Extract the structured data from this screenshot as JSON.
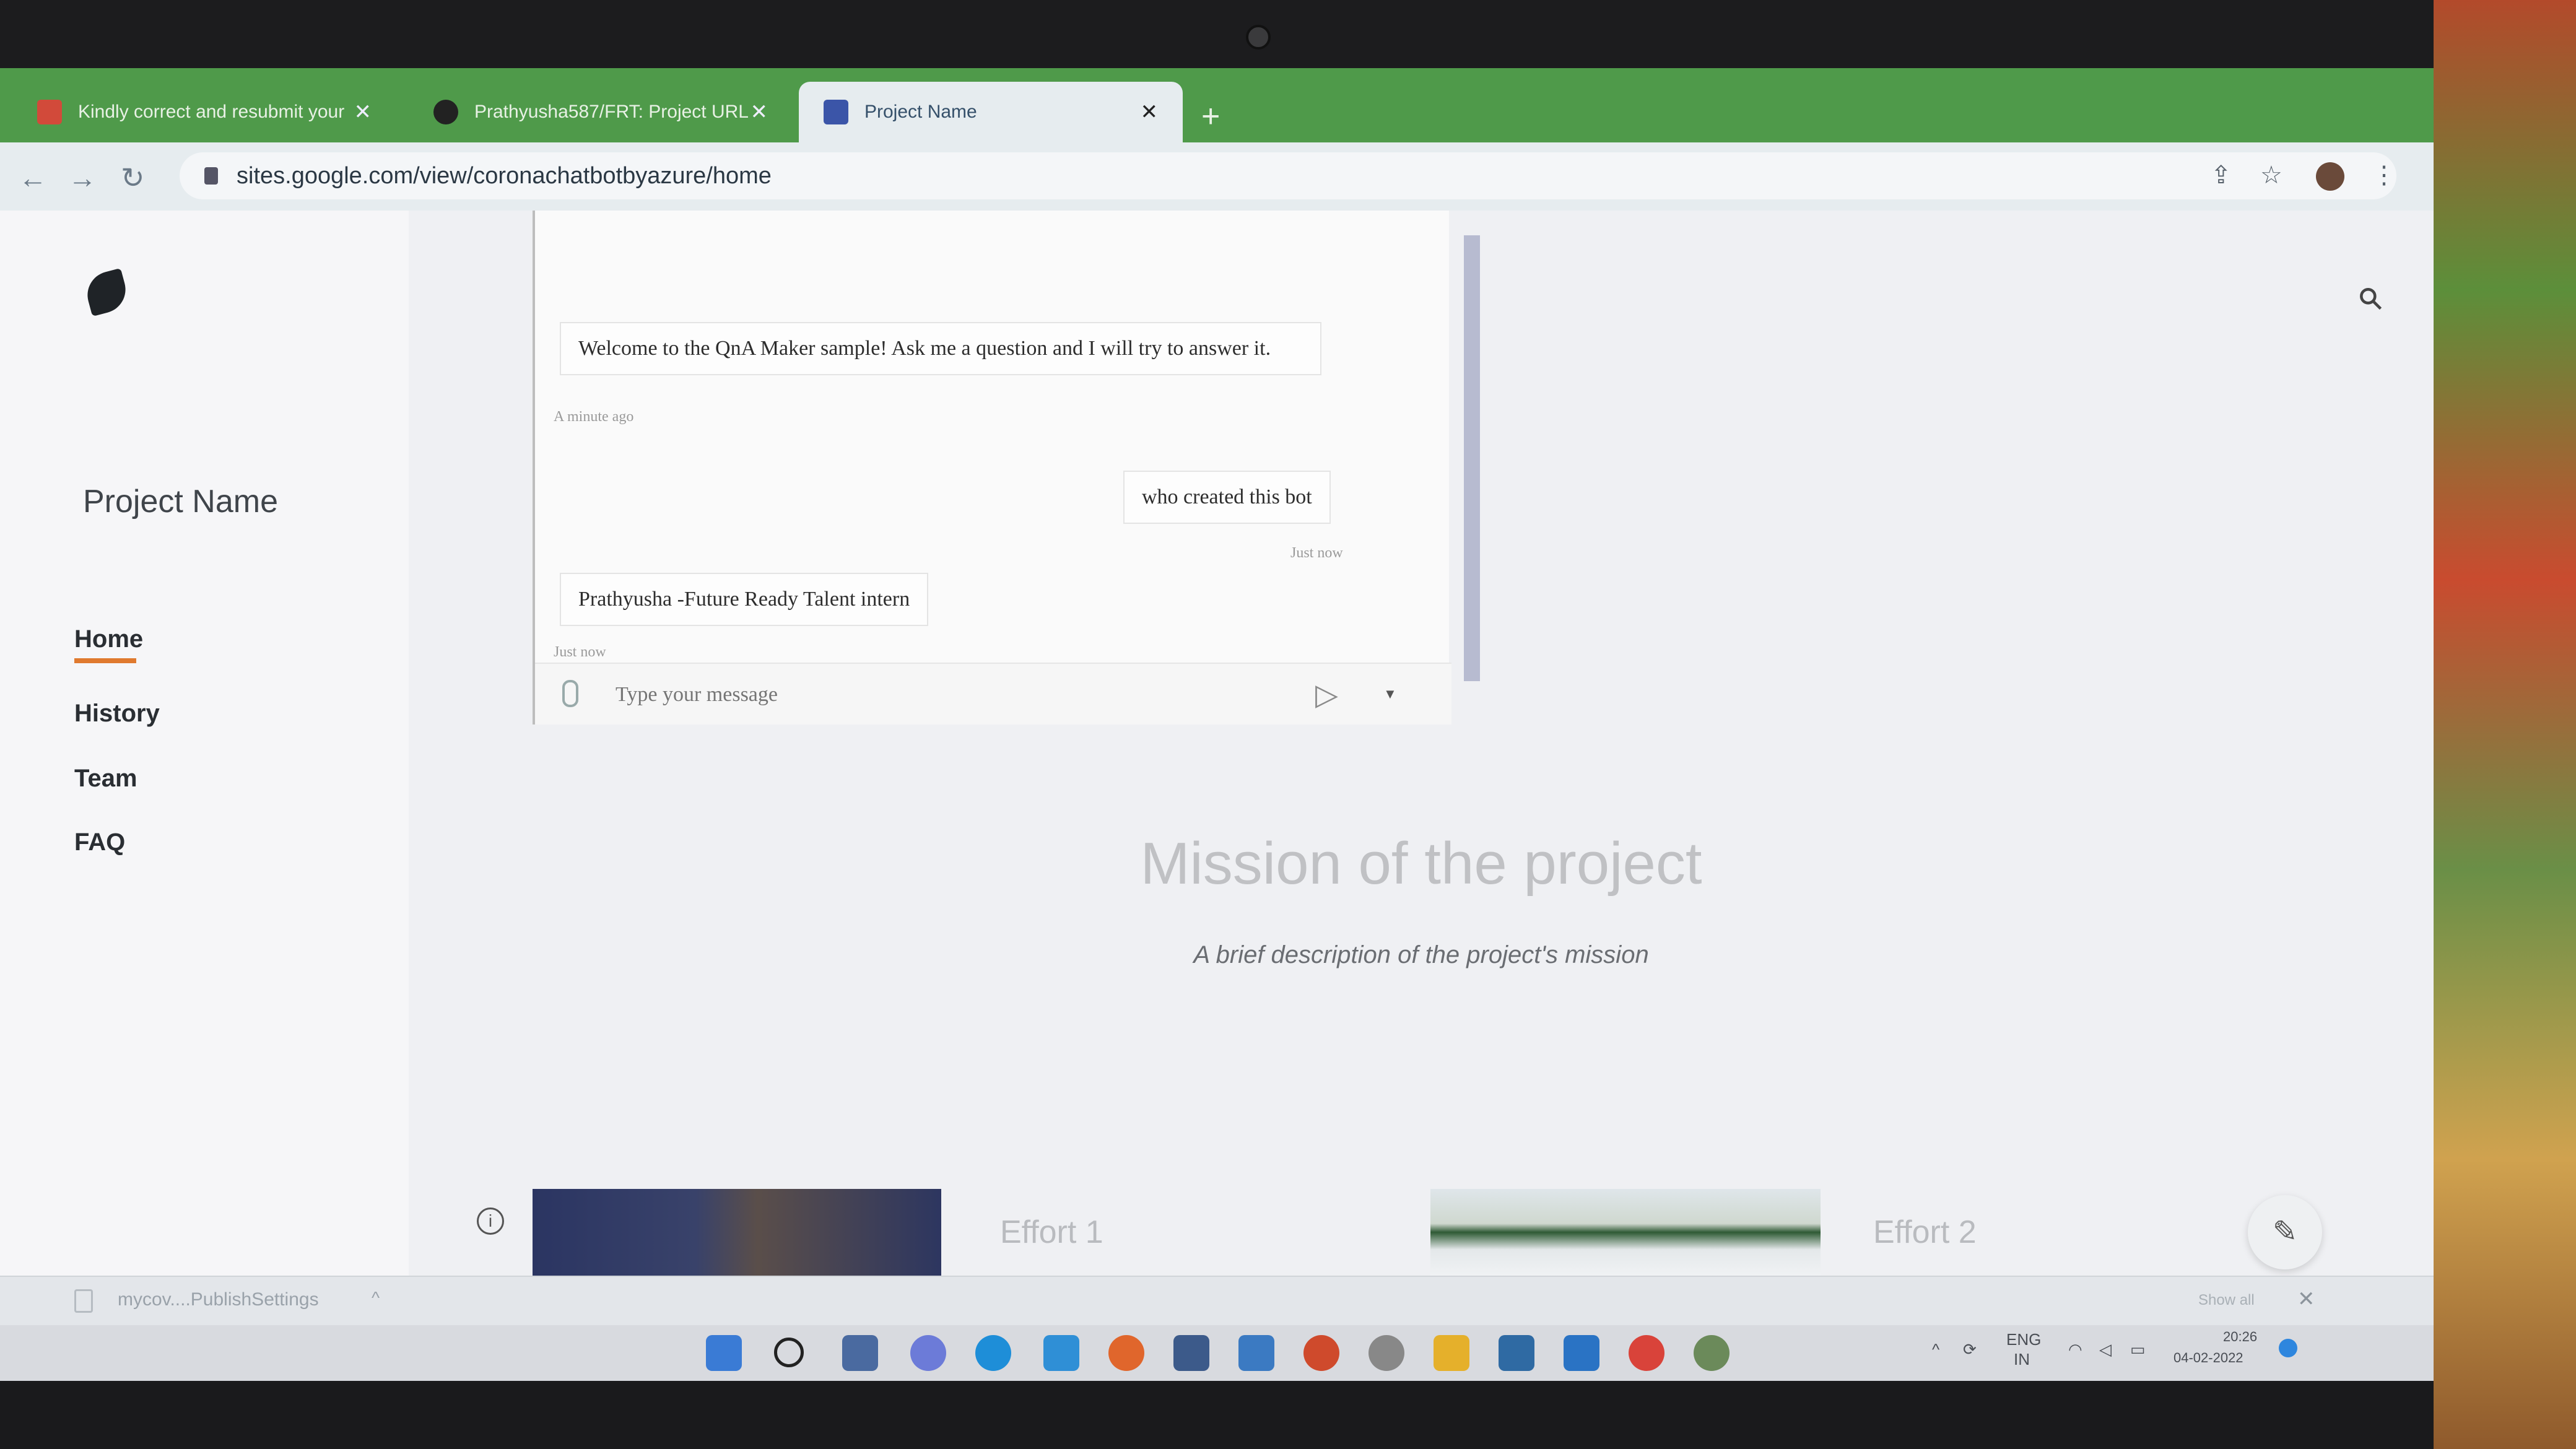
{
  "browser": {
    "tabs": [
      {
        "title": "Kindly correct and resubmit your",
        "close": "✕"
      },
      {
        "title": "Prathyusha587/FRT: Project URL",
        "close": "✕"
      },
      {
        "title": "Project Name",
        "close": "✕"
      }
    ],
    "new_tab": "+",
    "url": "sites.google.com/view/coronachatbotbyazure/home"
  },
  "site": {
    "project_name": "Project Name",
    "nav": [
      "Home",
      "History",
      "Team",
      "FAQ"
    ],
    "active_nav": "Home"
  },
  "chat": {
    "messages": [
      {
        "from": "bot",
        "text": "Welcome to the QnA Maker sample! Ask me a question and I will try to answer it.",
        "time": "A minute ago"
      },
      {
        "from": "user",
        "text": "who created this bot",
        "time": "Just now"
      },
      {
        "from": "bot",
        "text": "Prathyusha -Future Ready Talent intern",
        "time": "Just now"
      }
    ],
    "input_placeholder": "Type your message"
  },
  "mission": {
    "title": "Mission of the project",
    "description": "A brief description of the project's mission"
  },
  "efforts": [
    "Effort 1",
    "Effort 2"
  ],
  "download_bar": {
    "file": "mycov....PublishSettings",
    "show_all": "Show all",
    "close": "✕"
  },
  "tray": {
    "lang_line1": "ENG",
    "lang_line2": "IN",
    "time": "20:26",
    "date": "04-02-2022"
  }
}
